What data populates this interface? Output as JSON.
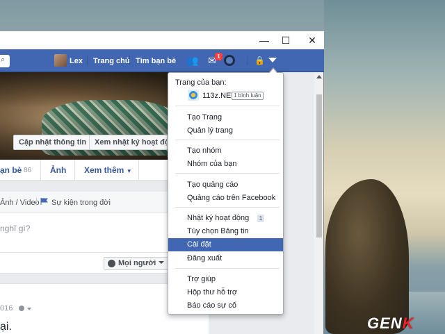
{
  "window": {
    "controls": {
      "minimize": "—",
      "maximize": "☐",
      "close": "✕"
    }
  },
  "navbar": {
    "user_name": "Lex",
    "home": "Trang chủ",
    "find_friends": "Tìm bạn bè",
    "messages_badge": "1",
    "search_icon": "search-icon"
  },
  "cover": {
    "update_info_button": "Cập nhật thông tin",
    "activity_log_button": "Xem nhật ký hoạt động"
  },
  "tabs": {
    "friends": "ạn bè",
    "friends_count": "86",
    "photos": "Ảnh",
    "more": "Xem thêm"
  },
  "composer": {
    "photo_video": "Ảnh / Video",
    "life_event": "Sự kiện trong đời",
    "placeholder": "nghĩ gì?",
    "audience": "Mọi người"
  },
  "post": {
    "time": "016",
    "text": "ại."
  },
  "menu": {
    "your_pages_heading": "Trang của bạn:",
    "page_name": "113z.NET",
    "page_badge": "1 bình luận",
    "items": [
      "Tạo Trang",
      "Quản lý trang",
      "Tạo nhóm",
      "Nhóm của bạn",
      "Tạo quảng cáo",
      "Quảng cáo trên Facebook",
      "Nhật ký hoạt động",
      "Tùy chọn Bảng tin",
      "Cài đặt",
      "Đăng xuất",
      "Trợ giúp",
      "Hộp thư hỗ trợ",
      "Báo cáo sự cố"
    ],
    "activity_count": "1",
    "highlighted": "Cài đặt"
  },
  "watermark": {
    "main": "GEN",
    "accent": "K"
  },
  "colors": {
    "fb_blue": "#4267b2",
    "link": "#365899",
    "highlight": "#4267b2"
  }
}
